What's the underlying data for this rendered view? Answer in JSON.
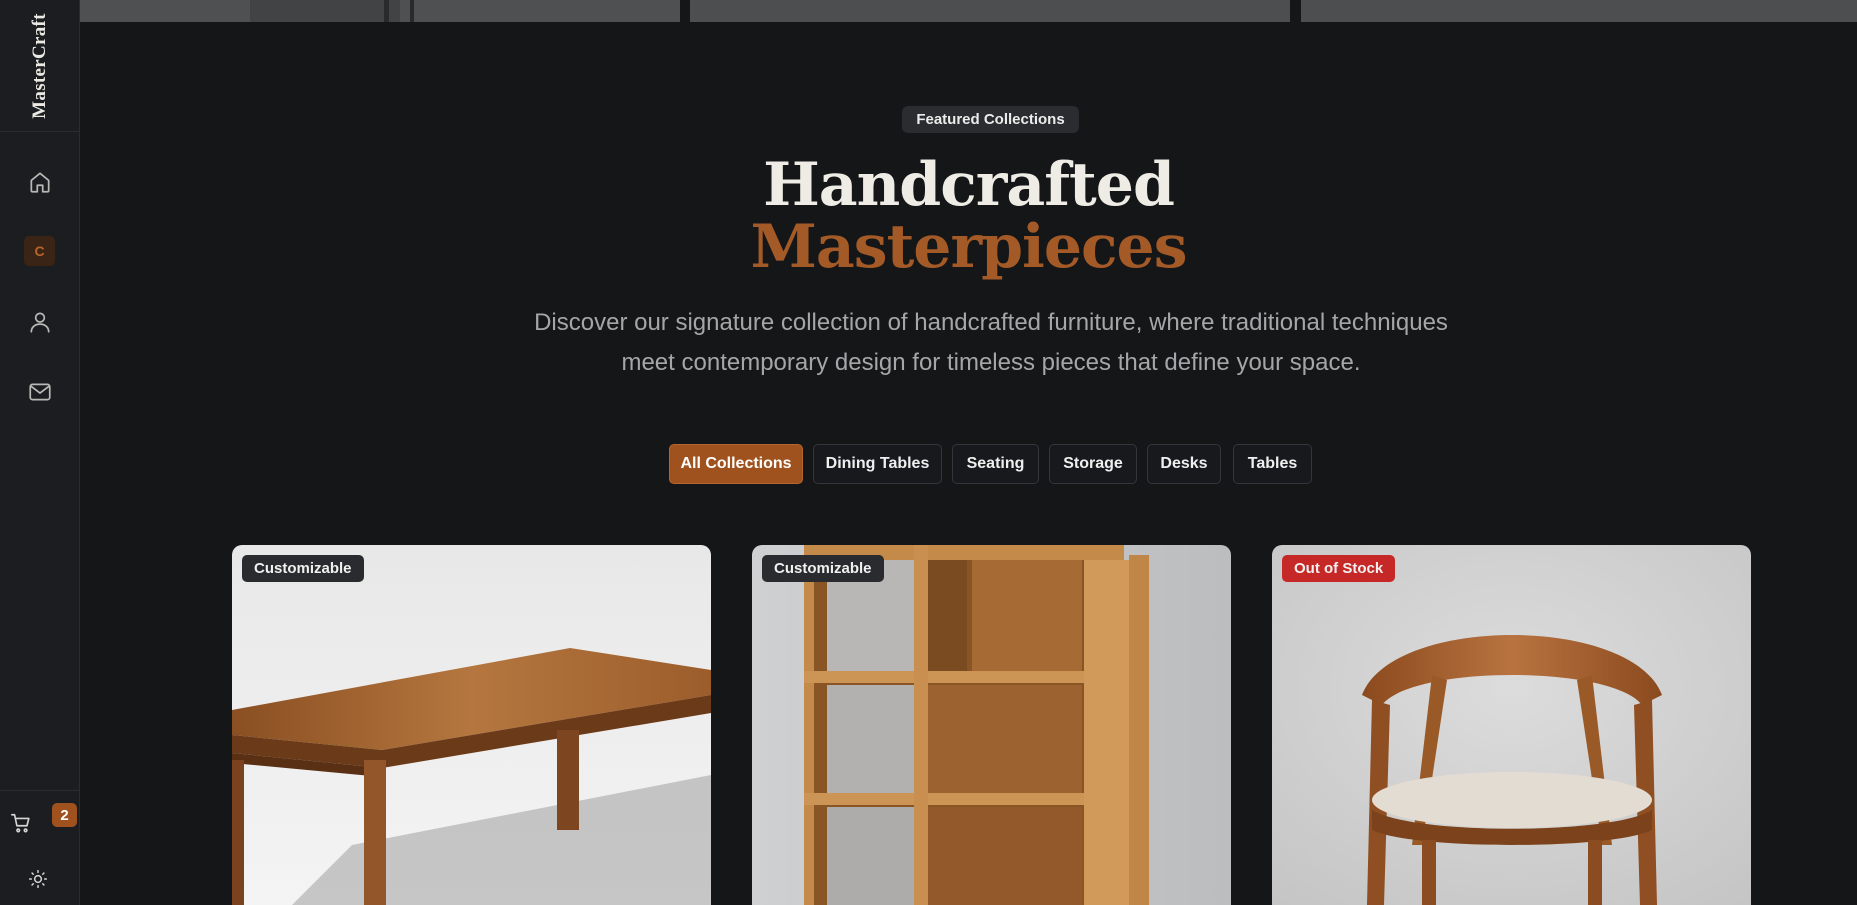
{
  "brand": "MasterCraft",
  "sidebar": {
    "nav": [
      {
        "name": "home",
        "icon": "home-icon"
      },
      {
        "name": "collections",
        "label": "C"
      },
      {
        "name": "account",
        "icon": "user-icon"
      },
      {
        "name": "contact",
        "icon": "mail-icon"
      }
    ],
    "cart_count": "2",
    "theme_icon": "sun-icon"
  },
  "hero": {
    "eyebrow": "Featured Collections",
    "title_line1": "Handcrafted",
    "title_line2": "Masterpieces",
    "subtitle": "Discover our signature collection of handcrafted furniture, where traditional techniques meet contemporary design for timeless pieces that define your space."
  },
  "filters": [
    {
      "label": "All Collections",
      "active": true
    },
    {
      "label": "Dining Tables",
      "active": false
    },
    {
      "label": "Seating",
      "active": false
    },
    {
      "label": "Storage",
      "active": false
    },
    {
      "label": "Desks",
      "active": false
    },
    {
      "label": "Tables",
      "active": false
    }
  ],
  "products": [
    {
      "badge": "Customizable",
      "image": "walnut-dining-table"
    },
    {
      "badge": "Customizable",
      "image": "oak-bookshelf"
    },
    {
      "badge": "Out of Stock",
      "image": "walnut-armchair"
    }
  ],
  "colors": {
    "accent": "#a0521e",
    "accent_text": "#a45a27",
    "out_of_stock": "#c62828",
    "background": "#141618",
    "sidebar": "#1b1d20"
  }
}
